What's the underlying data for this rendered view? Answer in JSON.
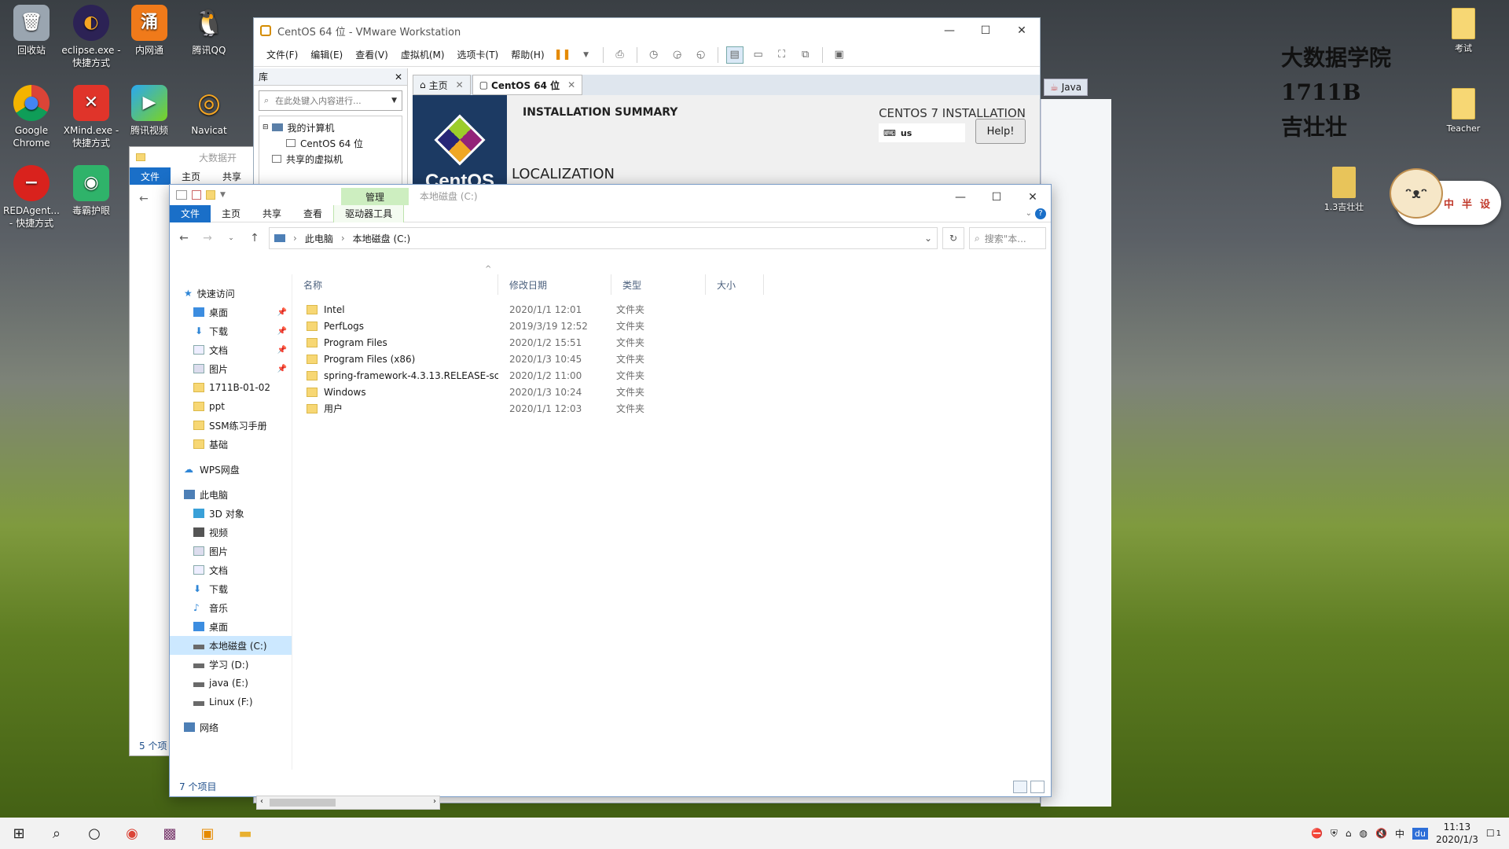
{
  "desktop": {
    "icons": [
      {
        "label": "回收站",
        "glyph": "🗑",
        "color": "#9aa5b0"
      },
      {
        "label": "eclipse.exe - 快捷方式",
        "glyph": "◐",
        "color": "#2c2255"
      },
      {
        "label": "内网通",
        "glyph": "涌",
        "color": "#f07a1a"
      },
      {
        "label": "腾讯QQ",
        "glyph": "🐧",
        "color": "#ffffff"
      },
      {
        "label": "Google Chrome",
        "glyph": "◉",
        "color": "#e3e3e3"
      },
      {
        "label": "XMind.exe - 快捷方式",
        "glyph": "✕",
        "color": "#e0342a"
      },
      {
        "label": "腾讯视频",
        "glyph": "▶",
        "color": "#2aa8f2"
      },
      {
        "label": "Navicat",
        "glyph": "◎",
        "color": "#2b2b2b"
      },
      {
        "label": "REDAgent... - 快捷方式",
        "glyph": "⛔",
        "color": "#d9221d"
      },
      {
        "label": "毒霸护眼",
        "glyph": "◉",
        "color": "#2fb36a"
      }
    ],
    "right_icons": [
      {
        "label": "考试"
      },
      {
        "label": "Teacher"
      },
      {
        "label": "1.3吉壮壮"
      }
    ],
    "watermark": [
      "大数据学院",
      "1711B",
      "吉壮壮"
    ],
    "pet_labels": [
      "中",
      "半",
      "设"
    ]
  },
  "vmware": {
    "title": "CentOS 64 位 - VMware Workstation",
    "menu": [
      "文件(F)",
      "编辑(E)",
      "查看(V)",
      "虚拟机(M)",
      "选项卡(T)",
      "帮助(H)"
    ],
    "library": {
      "header": "库",
      "search_placeholder": "在此处键入内容进行...",
      "tree": [
        "我的计算机",
        "CentOS 64 位",
        "共享的虚拟机"
      ]
    },
    "tabs": [
      {
        "label": "主页"
      },
      {
        "label": "CentOS 64 位"
      }
    ],
    "guest": {
      "brand": "CentOS",
      "summary": "INSTALLATION SUMMARY",
      "product": "CENTOS 7 INSTALLATION",
      "keyboard": "us",
      "help": "Help!",
      "section": "LOCALIZATION"
    }
  },
  "java_button": "Java",
  "explorer_bg": {
    "ribbon": [
      "文件",
      "主页",
      "共享"
    ],
    "path_partial": "大数据开",
    "status": "5 个项"
  },
  "explorer": {
    "title": "本地磁盘 (C:)",
    "context_tab_header": "管理",
    "ribbon_tabs": [
      "文件",
      "主页",
      "共享",
      "查看",
      "驱动器工具"
    ],
    "breadcrumb": [
      "此电脑",
      "本地磁盘 (C:)"
    ],
    "search_placeholder": "搜索\"本...",
    "columns": [
      "名称",
      "修改日期",
      "类型",
      "大小"
    ],
    "nav": {
      "quick_access": "快速访问",
      "quick_items": [
        "桌面",
        "下载",
        "文档",
        "图片",
        "1711B-01-02",
        "ppt",
        "SSM练习手册",
        "基础"
      ],
      "wps": "WPS网盘",
      "this_pc": "此电脑",
      "pc_items": [
        "3D 对象",
        "视频",
        "图片",
        "文档",
        "下载",
        "音乐",
        "桌面",
        "本地磁盘 (C:)",
        "学习 (D:)",
        "java (E:)",
        "Linux (F:)"
      ],
      "network": "网络"
    },
    "files": [
      {
        "name": "Intel",
        "date": "2020/1/1 12:01",
        "type": "文件夹"
      },
      {
        "name": "PerfLogs",
        "date": "2019/3/19 12:52",
        "type": "文件夹"
      },
      {
        "name": "Program Files",
        "date": "2020/1/2 15:51",
        "type": "文件夹"
      },
      {
        "name": "Program Files (x86)",
        "date": "2020/1/3 10:45",
        "type": "文件夹"
      },
      {
        "name": "spring-framework-4.3.13.RELEASE-sc...",
        "date": "2020/1/2 11:00",
        "type": "文件夹"
      },
      {
        "name": "Windows",
        "date": "2020/1/3 10:24",
        "type": "文件夹"
      },
      {
        "name": "用户",
        "date": "2020/1/1 12:03",
        "type": "文件夹"
      }
    ],
    "status": "7 个项目"
  },
  "taskbar": {
    "time": "11:13",
    "date": "2020/1/3",
    "ime": "du",
    "notification_count": "1"
  }
}
